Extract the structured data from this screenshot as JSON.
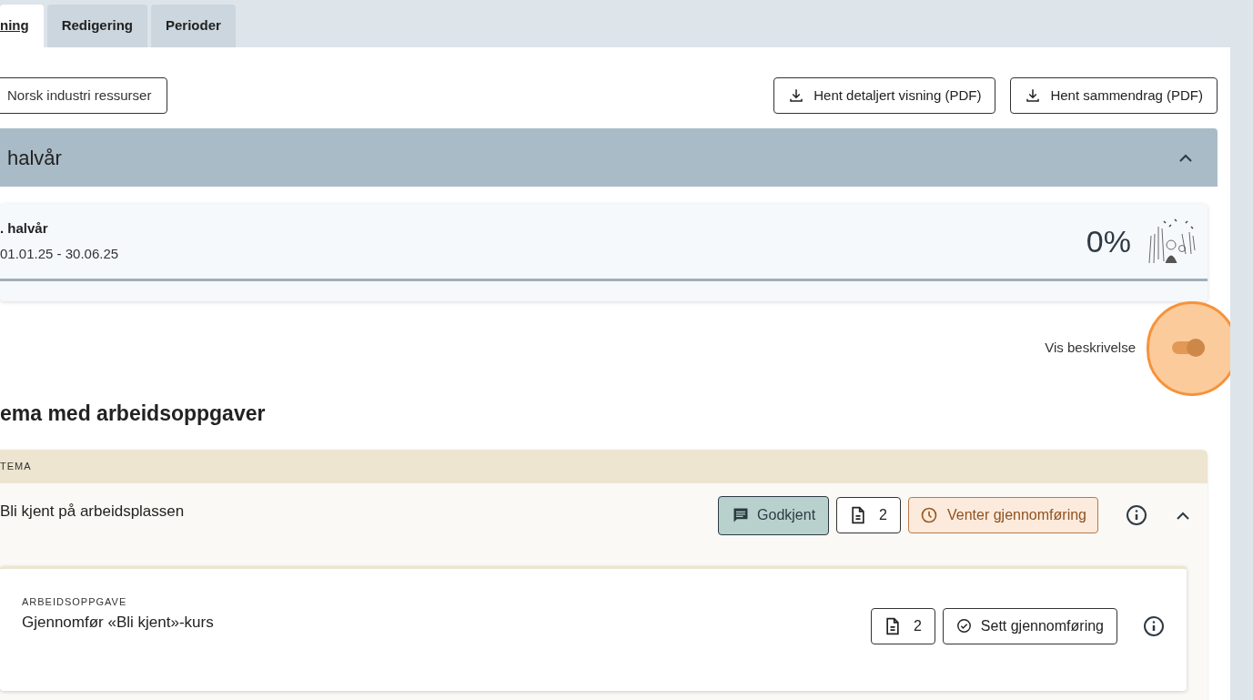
{
  "tabs": [
    {
      "label": "ning",
      "selected": true
    },
    {
      "label": "Redigering",
      "selected": false
    },
    {
      "label": "Perioder",
      "selected": false
    }
  ],
  "resource_button": "Norsk industri ressurser",
  "downloads": [
    "Hent detaljert visning (PDF)",
    "Hent sammendrag (PDF)"
  ],
  "section": {
    "title": "halvår",
    "expanded": true
  },
  "period_card": {
    "title": ". halvår",
    "dates": "01.01.25 - 30.06.25",
    "percent": "0%",
    "level": 0
  },
  "description_toggle": {
    "label": "Vis beskrivelse",
    "on": true
  },
  "heading": "ema med arbeidsoppgaver",
  "theme": {
    "header": "TEMA",
    "title": "Bli kjent på arbeidsplassen",
    "expanded": true,
    "actions": [
      {
        "kind": "comment",
        "label": "Godkjent"
      },
      {
        "kind": "documents",
        "label": "2"
      },
      {
        "kind": "pending",
        "label": "Venter gjennomføring"
      }
    ],
    "tasks": [
      {
        "eyebrow": "ARBEIDSOPPGAVE",
        "title": "Gjennomfør «Bli kjent»-kurs",
        "actions": [
          {
            "kind": "documents",
            "label": "2"
          },
          {
            "kind": "complete",
            "label": "Sett gjennomføring"
          }
        ]
      }
    ]
  }
}
